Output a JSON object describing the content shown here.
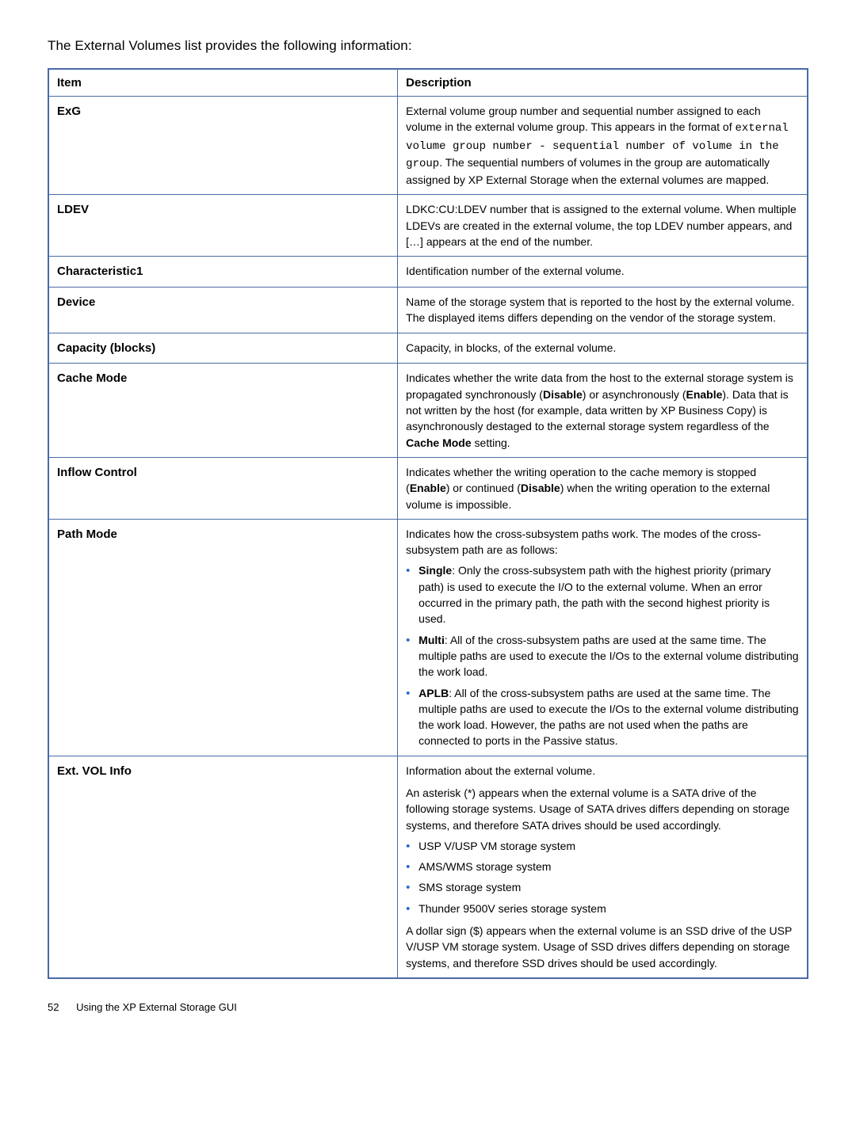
{
  "intro": "The External Volumes list provides the following information:",
  "headers": {
    "item": "Item",
    "description": "Description"
  },
  "rows": {
    "exg": {
      "item": "ExG",
      "d1": "External volume group number and sequential number assigned to each volume in the external volume group. This appears in the format of ",
      "c1": "external volume group number - sequential number of volume in the group",
      "d2": ". The sequential numbers of volumes in the group are automatically assigned by XP External Storage when the external volumes are mapped."
    },
    "ldev": {
      "item": "LDEV",
      "desc": "LDKC:CU:LDEV number that is assigned to the external volume. When multiple LDEVs are created in the external volume, the top LDEV number appears, and […] appears at the end of the number."
    },
    "char1": {
      "item": "Characteristic1",
      "desc": "Identification number of the external volume."
    },
    "device": {
      "item": "Device",
      "desc": "Name of the storage system that is reported to the host by the external volume. The displayed items differs depending on the vendor of the storage system."
    },
    "capacity": {
      "item": "Capacity (blocks)",
      "desc": "Capacity, in blocks, of the external volume."
    },
    "cache": {
      "item": "Cache Mode",
      "d1": "Indicates whether the write data from the host to the external storage system is propagated synchronously (",
      "b1": "Disable",
      "d2": ") or asynchronously (",
      "b2": "Enable",
      "d3": "). Data that is not written by the host (for example, data written by XP Business Copy) is asynchronously destaged to the external storage system regardless of the ",
      "b3": "Cache Mode",
      "d4": " setting."
    },
    "inflow": {
      "item": "Inflow Control",
      "d1": "Indicates whether the writing operation to the cache memory is stopped (",
      "b1": "Enable",
      "d2": ") or continued (",
      "b2": "Disable",
      "d3": ") when the writing operation to the external volume is impossible."
    },
    "path": {
      "item": "Path Mode",
      "lead": "Indicates how the cross-subsystem paths work. The modes of the cross-subsystem path are as follows:",
      "li1b": "Single",
      "li1": ": Only the cross-subsystem path with the highest priority (primary path) is used to execute the I/O to the external volume. When an error occurred in the primary path, the path with the second highest priority is used.",
      "li2b": "Multi",
      "li2": ": All of the cross-subsystem paths are used at the same time. The multiple paths are used to execute the I/Os to the external volume distributing the work load.",
      "li3b": "APLB",
      "li3": ": All of the cross-subsystem paths are used at the same time. The multiple paths are used to execute the I/Os to the external volume distributing the work load. However, the paths are not used when the paths are connected to ports in the Passive status."
    },
    "ext": {
      "item": "Ext. VOL Info",
      "p1": "Information about the external volume.",
      "p2": "An asterisk (*) appears when the external volume is a SATA drive of the following storage systems. Usage of SATA drives differs depending on storage systems, and therefore SATA drives should be used accordingly.",
      "li1": "USP V/USP VM storage system",
      "li2": "AMS/WMS storage system",
      "li3": "SMS storage system",
      "li4": "Thunder 9500V series storage system",
      "p3": "A dollar sign ($) appears when the external volume is an SSD drive of the USP V/USP VM storage system. Usage of SSD drives differs depending on storage systems, and therefore SSD drives should be used accordingly."
    }
  },
  "footer": {
    "page": "52",
    "section": "Using the XP External Storage GUI"
  }
}
